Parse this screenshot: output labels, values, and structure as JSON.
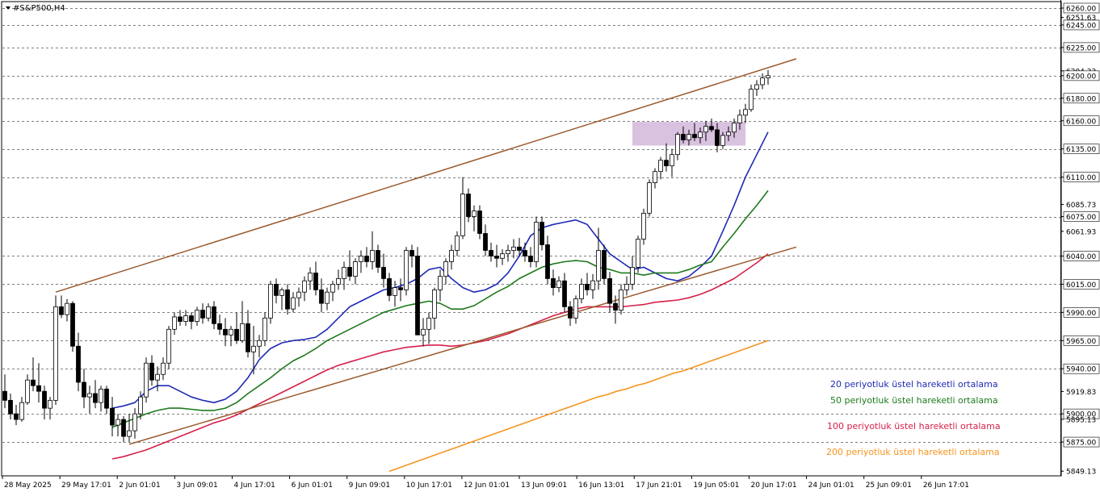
{
  "window": {
    "title": "#S&P500,H4",
    "menu_icon": "triangle-down-icon"
  },
  "chart_data": {
    "type": "candlestick",
    "symbol": "#S&P500",
    "timeframe": "H4",
    "ylim": [
      5845,
      6265
    ],
    "grid": "horizontal-dashed",
    "price_axis": {
      "labels": [
        {
          "value": 6260.0,
          "text": "6260.00"
        },
        {
          "value": 6251.63,
          "text": "6251.63"
        },
        {
          "value": 6245.0,
          "text": "6245.00"
        },
        {
          "value": 6225.0,
          "text": "6225.00"
        },
        {
          "value": 6204.33,
          "text": "6204.33"
        },
        {
          "value": 6200.0,
          "text": "6200.00"
        },
        {
          "value": 6180.0,
          "text": "6180.00"
        },
        {
          "value": 6160.0,
          "text": "6160.00"
        },
        {
          "value": 6135.0,
          "text": "6135.00"
        },
        {
          "value": 6110.0,
          "text": "6110.00"
        },
        {
          "value": 6085.73,
          "text": "6085.73"
        },
        {
          "value": 6075.0,
          "text": "6075.00"
        },
        {
          "value": 6061.93,
          "text": "6061.93"
        },
        {
          "value": 6040.0,
          "text": "6040.00"
        },
        {
          "value": 6015.0,
          "text": "6015.00"
        },
        {
          "value": 5990.0,
          "text": "5990.00"
        },
        {
          "value": 5965.0,
          "text": "5965.00"
        },
        {
          "value": 5940.0,
          "text": "5940.00"
        },
        {
          "value": 5919.83,
          "text": "5919.83"
        },
        {
          "value": 5900.0,
          "text": "5900.00"
        },
        {
          "value": 5895.13,
          "text": "5895.13"
        },
        {
          "value": 5875.0,
          "text": "5875.00"
        },
        {
          "value": 5849.13,
          "text": "5849.13"
        }
      ],
      "boxed": [
        "6260.00",
        "6245.00",
        "6225.00",
        "6200.00",
        "6180.00",
        "6160.00",
        "6135.00",
        "6110.00",
        "6075.00",
        "6040.00",
        "6015.00",
        "5990.00",
        "5965.00",
        "5940.00",
        "5900.00",
        "5875.00"
      ],
      "gridlines": [
        6260,
        6245,
        6225,
        6200,
        6180,
        6160,
        6135,
        6110,
        6075,
        6040,
        6015,
        5990,
        5965,
        5940,
        5900,
        5875
      ]
    },
    "time_axis": [
      "28 May 2025",
      "29 May 17:01",
      "2 Jun 01:01",
      "3 Jun 09:01",
      "4 Jun 17:01",
      "6 Jun 01:01",
      "9 Jun 09:01",
      "10 Jun 17:01",
      "12 Jun 01:01",
      "13 Jun 09:01",
      "16 Jun 13:01",
      "17 Jun 21:01",
      "19 Jun 05:01",
      "20 Jun 17:01",
      "24 Jun 01:01",
      "25 Jun 09:01",
      "26 Jun 17:01"
    ],
    "candles": [
      [
        5920,
        5935,
        5905,
        5912
      ],
      [
        5912,
        5918,
        5895,
        5900
      ],
      [
        5900,
        5908,
        5890,
        5895
      ],
      [
        5895,
        5915,
        5893,
        5910
      ],
      [
        5910,
        5935,
        5908,
        5930
      ],
      [
        5930,
        5950,
        5920,
        5925
      ],
      [
        5925,
        5945,
        5910,
        5920
      ],
      [
        5920,
        5925,
        5895,
        5905
      ],
      [
        5905,
        5915,
        5895,
        5912
      ],
      [
        5912,
        6005,
        5908,
        5995
      ],
      [
        5995,
        6005,
        5985,
        5988
      ],
      [
        5988,
        6002,
        5982,
        5998
      ],
      [
        5998,
        6000,
        5955,
        5960
      ],
      [
        5960,
        5972,
        5920,
        5928
      ],
      [
        5928,
        5940,
        5905,
        5915
      ],
      [
        5915,
        5925,
        5900,
        5918
      ],
      [
        5918,
        5930,
        5905,
        5910
      ],
      [
        5910,
        5925,
        5902,
        5922
      ],
      [
        5922,
        5925,
        5900,
        5905
      ],
      [
        5905,
        5915,
        5880,
        5890
      ],
      [
        5890,
        5900,
        5880,
        5895
      ],
      [
        5895,
        5898,
        5875,
        5880
      ],
      [
        5880,
        5900,
        5875,
        5885
      ],
      [
        5885,
        5905,
        5878,
        5900
      ],
      [
        5900,
        5920,
        5895,
        5915
      ],
      [
        5915,
        5950,
        5910,
        5945
      ],
      [
        5945,
        5952,
        5925,
        5930
      ],
      [
        5930,
        5942,
        5920,
        5935
      ],
      [
        5935,
        5950,
        5930,
        5945
      ],
      [
        5945,
        5978,
        5940,
        5975
      ],
      [
        5975,
        5990,
        5970,
        5986
      ],
      [
        5986,
        5992,
        5978,
        5982
      ],
      [
        5982,
        5992,
        5978,
        5987
      ],
      [
        5987,
        5990,
        5975,
        5982
      ],
      [
        5982,
        5995,
        5978,
        5992
      ],
      [
        5992,
        5998,
        5980,
        5985
      ],
      [
        5985,
        5998,
        5982,
        5995
      ],
      [
        5995,
        6000,
        5975,
        5980
      ],
      [
        5980,
        5988,
        5970,
        5975
      ],
      [
        5975,
        5985,
        5960,
        5970
      ],
      [
        5970,
        5978,
        5960,
        5975
      ],
      [
        5975,
        5990,
        5962,
        5965
      ],
      [
        5965,
        6000,
        5963,
        5980
      ],
      [
        5980,
        5992,
        5950,
        5955
      ],
      [
        5955,
        5978,
        5935,
        5960
      ],
      [
        5960,
        5970,
        5950,
        5965
      ],
      [
        5965,
        5990,
        5960,
        5985
      ],
      [
        5985,
        6018,
        5980,
        6015
      ],
      [
        6015,
        6020,
        5998,
        6005
      ],
      [
        6005,
        6012,
        5992,
        6010
      ],
      [
        6010,
        6015,
        5988,
        5993
      ],
      [
        5993,
        6008,
        5990,
        6003
      ],
      [
        6003,
        6012,
        5995,
        6008
      ],
      [
        6008,
        6022,
        6000,
        6018
      ],
      [
        6018,
        6030,
        6010,
        6025
      ],
      [
        6025,
        6035,
        6005,
        6010
      ],
      [
        6010,
        6020,
        5990,
        5998
      ],
      [
        5998,
        6012,
        5992,
        6008
      ],
      [
        6008,
        6018,
        6000,
        6015
      ],
      [
        6015,
        6028,
        6010,
        6020
      ],
      [
        6020,
        6035,
        6010,
        6030
      ],
      [
        6030,
        6045,
        6018,
        6022
      ],
      [
        6022,
        6038,
        6015,
        6035
      ],
      [
        6035,
        6045,
        6025,
        6040
      ],
      [
        6040,
        6048,
        6030,
        6035
      ],
      [
        6035,
        6062,
        6028,
        6045
      ],
      [
        6045,
        6050,
        6025,
        6030
      ],
      [
        6030,
        6042,
        6012,
        6020
      ],
      [
        6020,
        6025,
        6000,
        6005
      ],
      [
        6005,
        6018,
        5995,
        6012
      ],
      [
        6012,
        6020,
        6000,
        6010
      ],
      [
        6010,
        6048,
        6005,
        6045
      ],
      [
        6045,
        6050,
        6030,
        6040
      ],
      [
        6040,
        6048,
        5980,
        5970
      ],
      [
        5970,
        5985,
        5960,
        5975
      ],
      [
        5975,
        5990,
        5962,
        5985
      ],
      [
        5985,
        6012,
        5975,
        6010
      ],
      [
        6010,
        6028,
        6000,
        6022
      ],
      [
        6022,
        6038,
        6015,
        6035
      ],
      [
        6035,
        6050,
        6028,
        6045
      ],
      [
        6045,
        6062,
        6040,
        6058
      ],
      [
        6058,
        6110,
        6055,
        6095
      ],
      [
        6095,
        6100,
        6070,
        6075
      ],
      [
        6075,
        6085,
        6062,
        6080
      ],
      [
        6080,
        6085,
        6055,
        6060
      ],
      [
        6060,
        6068,
        6040,
        6045
      ],
      [
        6045,
        6052,
        6035,
        6040
      ],
      [
        6040,
        6050,
        6030,
        6038
      ],
      [
        6038,
        6046,
        6032,
        6042
      ],
      [
        6042,
        6050,
        6035,
        6045
      ],
      [
        6045,
        6055,
        6038,
        6048
      ],
      [
        6048,
        6056,
        6040,
        6045
      ],
      [
        6045,
        6052,
        6035,
        6040
      ],
      [
        6040,
        6048,
        6030,
        6035
      ],
      [
        6035,
        6075,
        6030,
        6070
      ],
      [
        6070,
        6075,
        6045,
        6050
      ],
      [
        6050,
        6058,
        6015,
        6020
      ],
      [
        6020,
        6028,
        6005,
        6012
      ],
      [
        6012,
        6022,
        6008,
        6018
      ],
      [
        6018,
        6025,
        5990,
        5995
      ],
      [
        5995,
        6000,
        5978,
        5985
      ],
      [
        5985,
        6005,
        5980,
        6002
      ],
      [
        6002,
        6020,
        5998,
        6015
      ],
      [
        6015,
        6025,
        6005,
        6010
      ],
      [
        6010,
        6024,
        6002,
        6018
      ],
      [
        6018,
        6065,
        6010,
        6045
      ],
      [
        6045,
        6050,
        6015,
        6020
      ],
      [
        6020,
        6026,
        5990,
        5998
      ],
      [
        5998,
        6005,
        5980,
        5992
      ],
      [
        5992,
        6015,
        5988,
        6010
      ],
      [
        6010,
        6022,
        6005,
        6015
      ],
      [
        6015,
        6040,
        6010,
        6030
      ],
      [
        6030,
        6058,
        6025,
        6055
      ],
      [
        6055,
        6082,
        6050,
        6078
      ],
      [
        6078,
        6108,
        6075,
        6105
      ],
      [
        6105,
        6118,
        6100,
        6115
      ],
      [
        6115,
        6128,
        6108,
        6125
      ],
      [
        6125,
        6140,
        6115,
        6120
      ],
      [
        6120,
        6135,
        6110,
        6130
      ],
      [
        6130,
        6150,
        6125,
        6148
      ],
      [
        6148,
        6155,
        6140,
        6143
      ],
      [
        6143,
        6152,
        6138,
        6148
      ],
      [
        6148,
        6158,
        6142,
        6145
      ],
      [
        6145,
        6154,
        6140,
        6150
      ],
      [
        6150,
        6160,
        6142,
        6155
      ],
      [
        6155,
        6162,
        6150,
        6152
      ],
      [
        6152,
        6158,
        6132,
        6138
      ],
      [
        6138,
        6150,
        6135,
        6147
      ],
      [
        6147,
        6155,
        6142,
        6150
      ],
      [
        6150,
        6162,
        6145,
        6158
      ],
      [
        6158,
        6170,
        6152,
        6165
      ],
      [
        6165,
        6175,
        6158,
        6170
      ],
      [
        6170,
        6192,
        6168,
        6188
      ],
      [
        6188,
        6196,
        6182,
        6192
      ],
      [
        6192,
        6202,
        6188,
        6198
      ],
      [
        6198,
        6205,
        6192,
        6200
      ]
    ],
    "moving_averages": [
      {
        "name": "20 periyotluk üstel hareketli ortalama",
        "period": 20,
        "color": "#1f2ab4",
        "values": [
          5905,
          5907,
          5910,
          5920,
          5925,
          5925,
          5920,
          5915,
          5912,
          5910,
          5913,
          5920,
          5932,
          5948,
          5958,
          5963,
          5965,
          5966,
          5968,
          5975,
          5985,
          5995,
          6000,
          6005,
          6010,
          6012,
          6015,
          6020,
          6028,
          6030,
          6020,
          6012,
          6008,
          6010,
          6015,
          6025,
          6040,
          6058,
          6065,
          6068,
          6070,
          6072,
          6068,
          6055,
          6042,
          6035,
          6028,
          6030,
          6025,
          6020,
          6018,
          6022,
          6030,
          6040,
          6062,
          6085,
          6110,
          6130,
          6150
        ]
      },
      {
        "name": "50 periyotluk üstel hareketli ortalama",
        "period": 50,
        "color": "#1d7a1d",
        "values": [
          5888,
          5892,
          5896,
          5900,
          5903,
          5905,
          5905,
          5904,
          5903,
          5903,
          5905,
          5910,
          5918,
          5925,
          5932,
          5940,
          5947,
          5952,
          5958,
          5965,
          5970,
          5975,
          5980,
          5985,
          5990,
          5993,
          5996,
          5998,
          6000,
          5998,
          5993,
          5993,
          5996,
          6002,
          6008,
          6013,
          6020,
          6025,
          6030,
          6033,
          6035,
          6036,
          6035,
          6030,
          6028,
          6025,
          6025,
          6023,
          6025,
          6025,
          6025,
          6028,
          6032,
          6035,
          6048,
          6060,
          6073,
          6085,
          6098
        ]
      },
      {
        "name": "100 periyotluk üstel hareketli ortalama",
        "period": 100,
        "color": "#d6204a",
        "values": [
          5860,
          5862,
          5865,
          5868,
          5872,
          5876,
          5880,
          5884,
          5888,
          5892,
          5895,
          5899,
          5904,
          5909,
          5914,
          5919,
          5924,
          5929,
          5934,
          5939,
          5943,
          5946,
          5949,
          5952,
          5955,
          5957,
          5959,
          5960,
          5961,
          5961,
          5960,
          5961,
          5963,
          5965,
          5968,
          5971,
          5975,
          5979,
          5983,
          5987,
          5990,
          5993,
          5995,
          5995,
          5995,
          5995,
          5996,
          5997,
          5999,
          6000,
          6001,
          6003,
          6006,
          6010,
          6015,
          6020,
          6027,
          6034,
          6042
        ]
      },
      {
        "name": "200 periyotluk üstel hareketli ortalama",
        "period": 200,
        "color": "#f7941d",
        "values": [
          5849,
          5852,
          5855,
          5858,
          5861,
          5864,
          5867,
          5870,
          5873,
          5876,
          5879,
          5882,
          5885,
          5888,
          5891,
          5894,
          5897,
          5900,
          5903,
          5906,
          5909,
          5912,
          5915,
          5917,
          5920,
          5922,
          5925,
          5927,
          5930,
          5933,
          5936,
          5938,
          5941,
          5944,
          5947,
          5950,
          5953,
          5956,
          5959,
          5962,
          5965
        ]
      }
    ],
    "channel": {
      "color": "#9b5a2e",
      "upper": {
        "from": {
          "bar": 9,
          "price": 6008
        },
        "to": {
          "bar": 140,
          "price": 6215
        }
      },
      "lower": {
        "from": {
          "bar": 22,
          "price": 5873
        },
        "to": {
          "bar": 140,
          "price": 6048
        }
      }
    },
    "zone": {
      "from_bar": 111,
      "to_bar": 131,
      "top": 6159,
      "bottom": 6138,
      "color": "#c9a7d3"
    },
    "legend": [
      {
        "text": "20 periyotluk üstel hareketli ortalama",
        "color": "#1f2ab4"
      },
      {
        "text": "50 periyotluk üstel hareketli ortalama",
        "color": "#1d7a1d"
      },
      {
        "text": "100 periyotluk üstel hareketli ortalama",
        "color": "#d6204a"
      },
      {
        "text": "200 periyotluk üstel hareketli ortalama",
        "color": "#f7941d"
      }
    ]
  }
}
